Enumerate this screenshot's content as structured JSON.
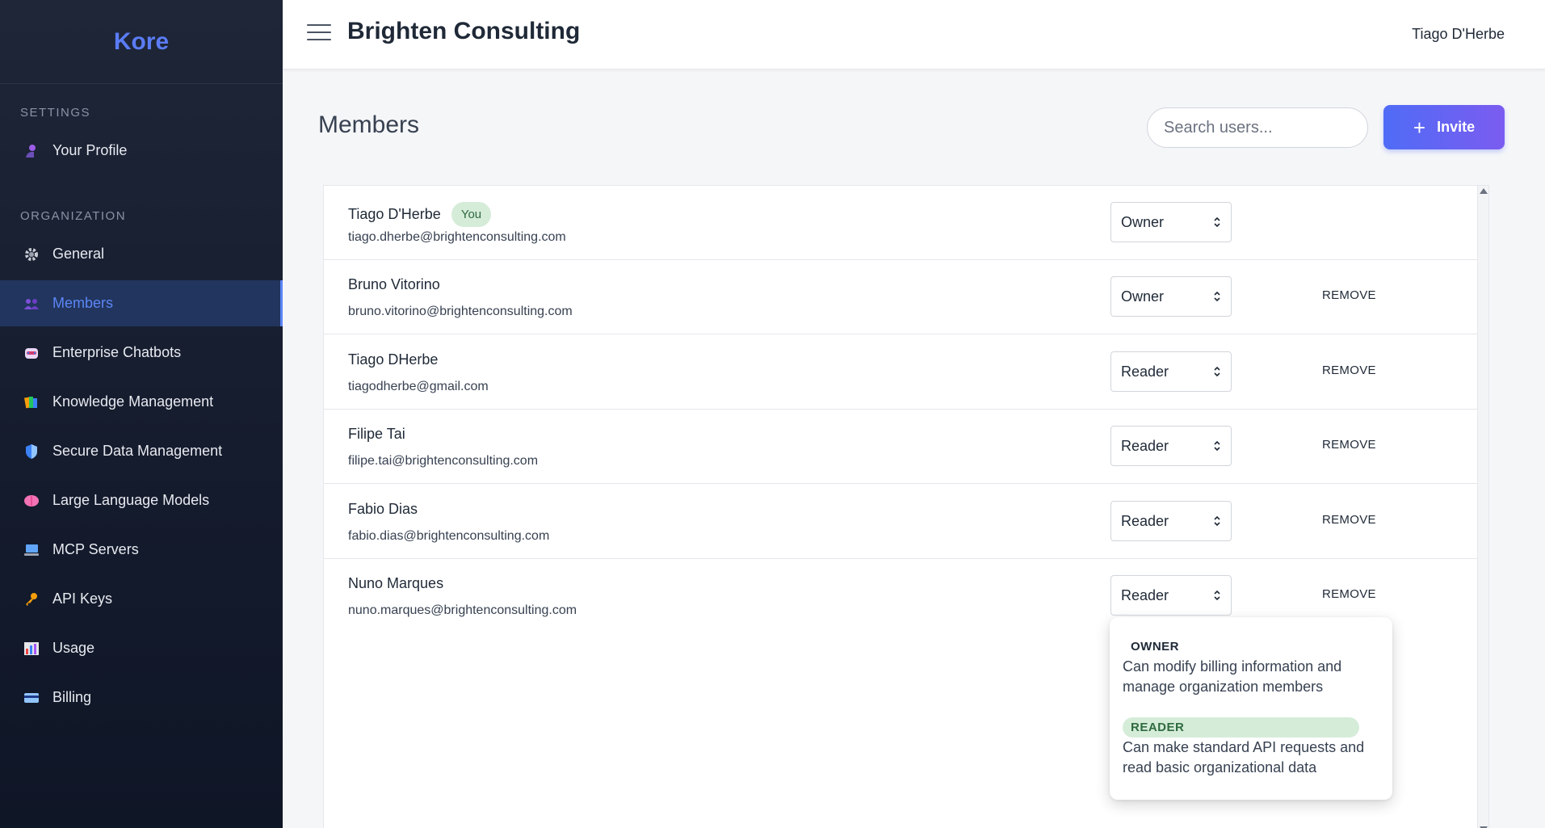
{
  "sidebar": {
    "brand": "Kore",
    "settings_title": "SETTINGS",
    "organization_title": "ORGANIZATION",
    "items": [
      {
        "label": "Your Profile",
        "icon": "person-icon"
      },
      {
        "label": "General",
        "icon": "gear-icon"
      },
      {
        "label": "Members",
        "icon": "people-icon"
      },
      {
        "label": "Enterprise Chatbots",
        "icon": "robot-icon"
      },
      {
        "label": "Knowledge Management",
        "icon": "books-icon"
      },
      {
        "label": "Secure Data Management",
        "icon": "shield-icon"
      },
      {
        "label": "Large Language Models",
        "icon": "brain-icon"
      },
      {
        "label": "MCP Servers",
        "icon": "computer-icon"
      },
      {
        "label": "API Keys",
        "icon": "key-icon"
      },
      {
        "label": "Usage",
        "icon": "chart-icon"
      },
      {
        "label": "Billing",
        "icon": "credit-card-icon"
      }
    ],
    "active_item": "Members"
  },
  "header": {
    "org_name": "Brighten Consulting",
    "user_name": "Tiago D'Herbe"
  },
  "main": {
    "title": "Members",
    "search_placeholder": "Search users...",
    "invite_label": "Invite",
    "you_badge": "You",
    "remove_label": "REMOVE",
    "members": [
      {
        "name": "Tiago D'Herbe",
        "email": "tiago.dherbe@brightenconsulting.com",
        "role": "Owner"
      },
      {
        "name": "Bruno Vitorino",
        "email": "bruno.vitorino@brightenconsulting.com",
        "role": "Owner"
      },
      {
        "name": "Tiago DHerbe",
        "email": "tiagodherbe@gmail.com",
        "role": "Reader"
      },
      {
        "name": "Filipe Tai",
        "email": "filipe.tai@brightenconsulting.com",
        "role": "Reader"
      },
      {
        "name": "Fabio Dias",
        "email": "fabio.dias@brightenconsulting.com",
        "role": "Reader"
      },
      {
        "name": "Nuno Marques",
        "email": "nuno.marques@brightenconsulting.com",
        "role": "Reader"
      }
    ]
  },
  "role_dropdown": {
    "options": [
      {
        "label": "OWNER",
        "description": "Can modify billing information and manage organization members"
      },
      {
        "label": "READER",
        "description": "Can make standard API requests and read basic organizational data"
      }
    ],
    "selected": "READER"
  },
  "colors": {
    "accent": "#5b86f5",
    "sidebar_bg": "#1a2234",
    "badge_bg": "#d5ecd9",
    "badge_text": "#2f6b3f"
  }
}
